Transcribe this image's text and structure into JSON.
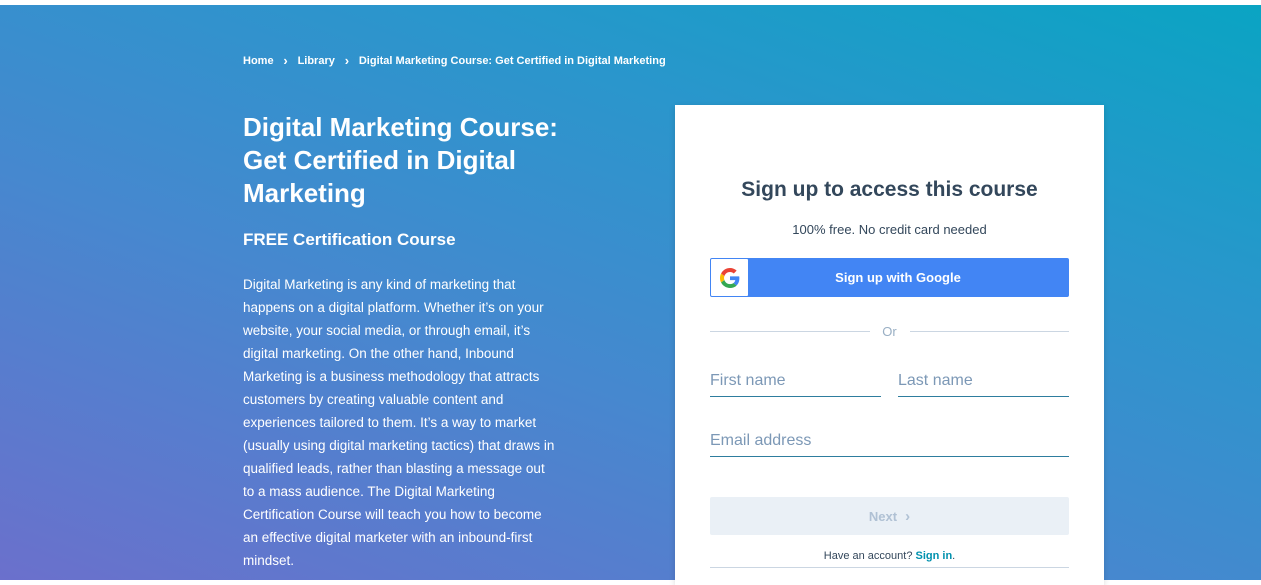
{
  "breadcrumb": {
    "items": [
      "Home",
      "Library",
      "Digital Marketing Course: Get Certified in Digital Marketing"
    ]
  },
  "hero": {
    "title_lines": [
      "Digital Marketing Course:",
      "Get Certified in Digital",
      "Marketing"
    ],
    "subtitle": "FREE Certification Course",
    "description_lines": [
      "Digital Marketing is any kind of marketing that",
      "happens on a digital platform. Whether it’s on your",
      "website, your social media, or through email, it’s",
      "digital marketing. On the other hand, Inbound",
      "Marketing is a business methodology that attracts",
      "customers by creating valuable content and",
      "experiences tailored to them. It’s a way to market",
      "(usually using digital marketing tactics) that draws in",
      "qualified leads, rather than blasting a message out",
      "to a mass audience. The Digital Marketing",
      "Certification Course will teach you how to become",
      "an effective digital marketer with an inbound-first",
      "mindset."
    ]
  },
  "signup": {
    "heading": "Sign up to access this course",
    "lead": "100% free. No credit card needed",
    "google_button": "Sign up with Google",
    "or_text": "Or",
    "first_name_placeholder": "First name",
    "last_name_placeholder": "Last name",
    "email_placeholder": "Email address",
    "next_label": "Next",
    "have_account_text": "Have an account?",
    "sign_in_link": "Sign in",
    "sign_in_suffix": "."
  },
  "colors": {
    "google_blue": "#4285f4",
    "heading": "#33475b",
    "link": "#0091ae"
  },
  "icons": {
    "google": "google-g-icon",
    "breadcrumb_separator": "chevron-right-icon",
    "next": "chevron-right-icon"
  }
}
